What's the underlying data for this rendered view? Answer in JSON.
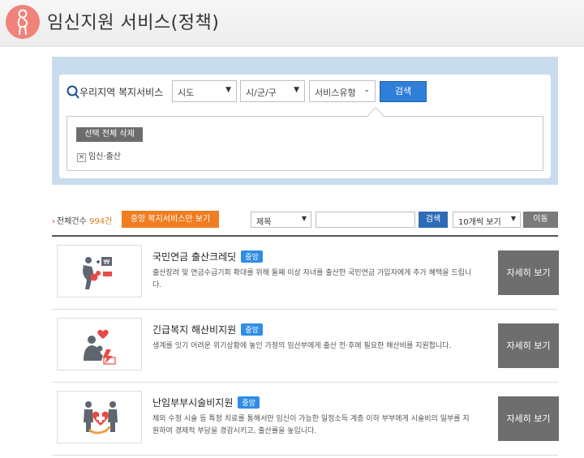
{
  "header": {
    "title": "임신지원 서비스(정책)",
    "icon": "pregnant-woman-icon"
  },
  "search": {
    "label": "우리지역 복지서비스",
    "sido": "시도",
    "sigungu": "시/군/구",
    "service_type": "서비스유형",
    "search_button": "검색",
    "clear_button": "선택 전체 삭제",
    "selected_chip": "임신·출산"
  },
  "list": {
    "total_label": "전체건수",
    "total_count": "994건",
    "central_button": "중앙 복지서비스만 보기",
    "filter_field": "제목",
    "keyword_button": "검색",
    "per_page": "10개씩 보기",
    "go_button": "이동"
  },
  "items": [
    {
      "title": "국민연금 출산크레딧",
      "badge": "중앙",
      "desc": "출산장려 및 연금수급기회 확대를 위해 둘째 이상 자녀를 출산한 국민연금 가입자에게 추가 혜택을 드립니다.",
      "button": "자세히 보기",
      "icon": "mother-baby-coin-icon"
    },
    {
      "title": "긴급복지 해산비지원",
      "badge": "중앙",
      "desc": "생계를 잇기 어려운 위기상황에 놓인 가정의 임산부에게 출산 전·후에 필요한 해산비를 지원합니다.",
      "button": "자세히 보기",
      "icon": "mother-child-heart-icon"
    },
    {
      "title": "난임부부시술비지원",
      "badge": "중앙",
      "desc": "체외 수정 시술 등 특정 치료를 통해서만 임신이 가능한 일정소득 계층 이하 부부에게 시술비의 일부를 지원하여 경제적 부담을 경감시키고, 출산률을 높입니다.",
      "button": "자세히 보기",
      "icon": "couple-heart-hand-icon"
    }
  ],
  "colors": {
    "accent": "#f07d21",
    "primary": "#2f7ed8",
    "badge": "#2f8de4",
    "header_icon": "#f08279"
  }
}
